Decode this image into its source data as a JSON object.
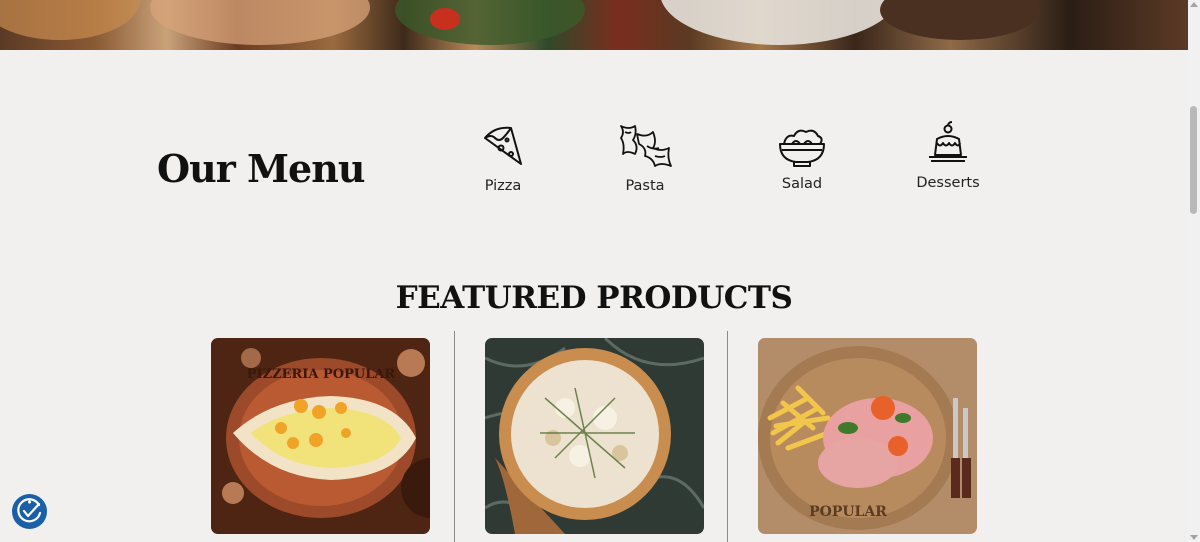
{
  "menu": {
    "title": "Our Menu",
    "categories": [
      {
        "label": "Pizza",
        "icon": "pizza-slice-icon"
      },
      {
        "label": "Pasta",
        "icon": "pasta-icon"
      },
      {
        "label": "Salad",
        "icon": "salad-bowl-icon"
      },
      {
        "label": "Desserts",
        "icon": "dessert-icon"
      }
    ]
  },
  "featured": {
    "heading": "FEATURED PRODUCTS",
    "products": [
      {
        "image": "egg-flatbread-pizza-photo",
        "board_text": "PIZZERIA POPULAR"
      },
      {
        "image": "white-pizza-photo"
      },
      {
        "image": "ham-fries-plate-photo",
        "board_text": "POPULAR"
      }
    ]
  },
  "colors": {
    "background": "#f1f0ef",
    "text": "#111111",
    "accessibility_button": "#1a5fa8"
  },
  "accessibility": {
    "icon": "accessibility-icon"
  }
}
